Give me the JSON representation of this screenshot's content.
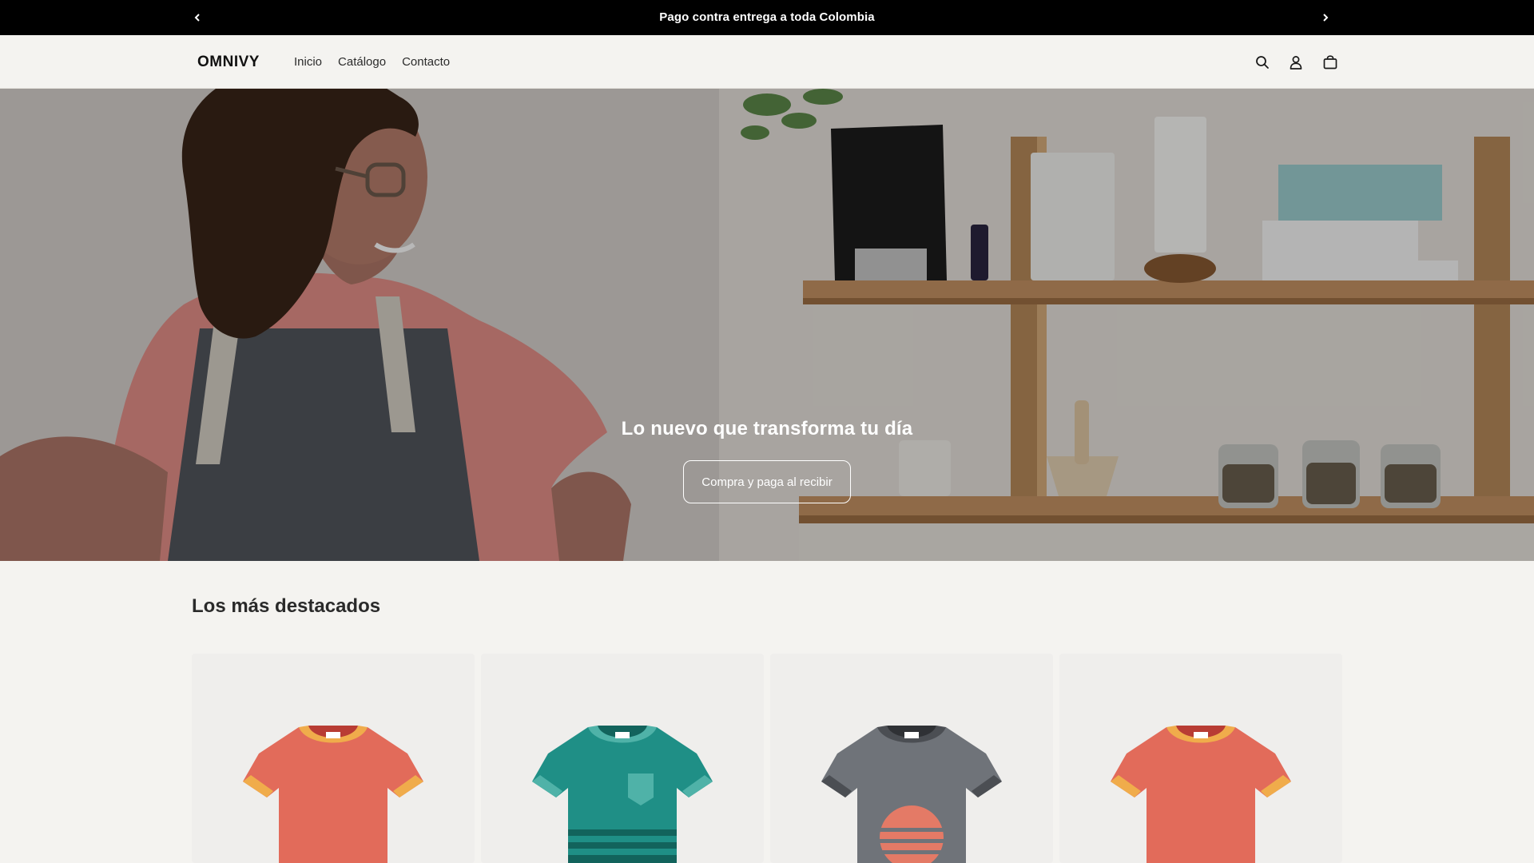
{
  "announcement": {
    "message": "Pago contra entrega a toda Colombia",
    "prev_icon": "chevron-left-icon",
    "next_icon": "chevron-right-icon"
  },
  "header": {
    "logo_text": "OMNIVY",
    "nav": [
      "Inicio",
      "Catálogo",
      "Contacto"
    ],
    "icons": [
      "search-icon",
      "account-icon",
      "cart-icon"
    ]
  },
  "hero": {
    "title": "Lo nuevo que transforma tu día",
    "button_label": "Compra y paga al recibir"
  },
  "featured": {
    "title": "Los más destacados",
    "products": [
      {
        "image": "tshirt-coral-icon",
        "colors": {
          "body": "#e26b5a",
          "trim": "#f0ac4b"
        }
      },
      {
        "image": "tshirt-teal-icon",
        "colors": {
          "body": "#1f8f86",
          "trim": "#4fb2a8"
        }
      },
      {
        "image": "tshirt-gray-icon",
        "colors": {
          "body": "#6f7379",
          "trim": "#4b4e53"
        }
      },
      {
        "image": "tshirt-coral-icon",
        "colors": {
          "body": "#e26b5a",
          "trim": "#f0ac4b"
        }
      }
    ]
  }
}
